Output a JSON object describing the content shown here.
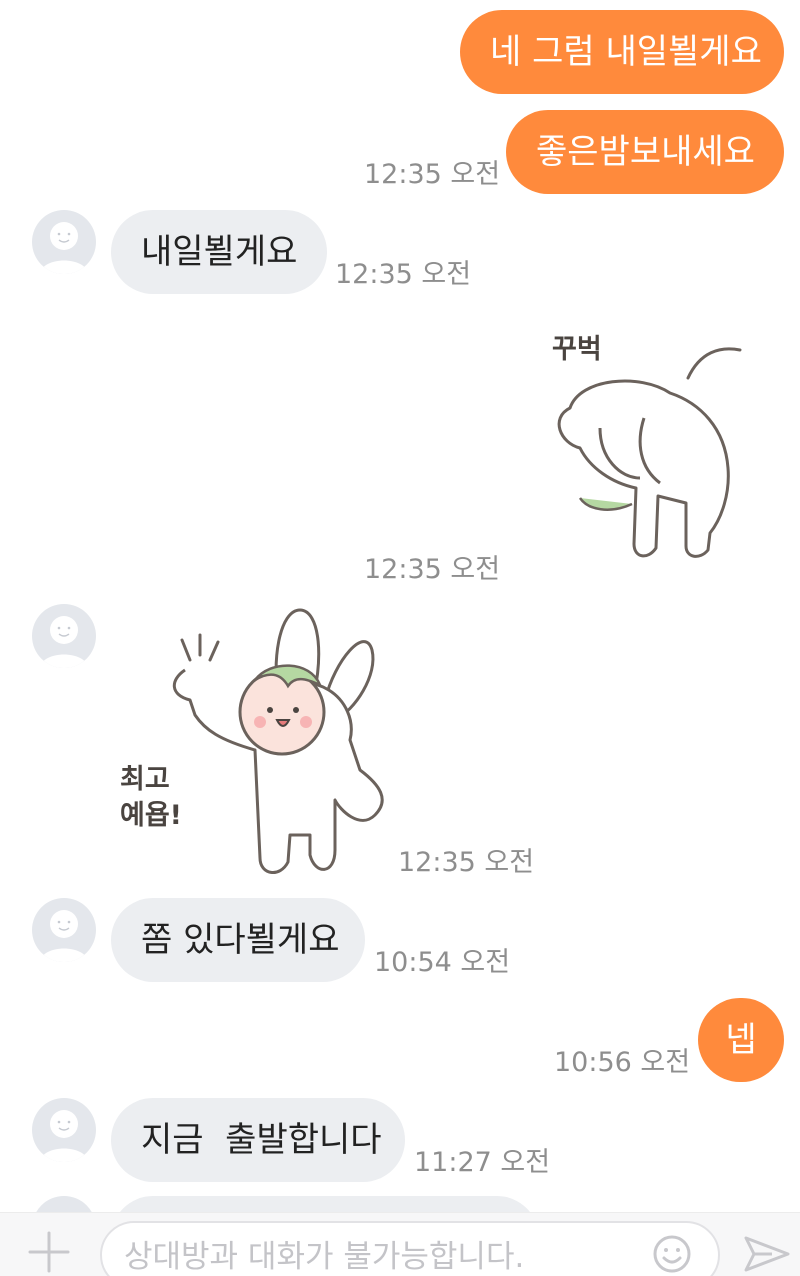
{
  "messages": [
    {
      "from": "me",
      "text": "네 그럼 내일뵐게요"
    },
    {
      "from": "me",
      "text": "좋은밤보내세요",
      "time": "12:35 오전"
    },
    {
      "from": "them",
      "text": "내일뵐게요",
      "time": "12:35 오전"
    },
    {
      "from": "me",
      "sticker_text": "꾸벅",
      "time": "12:35 오전"
    },
    {
      "from": "them",
      "sticker_text_1": "최고",
      "sticker_text_2": "예욥!",
      "time": "12:35 오전"
    },
    {
      "from": "them",
      "text": "쫌 있다뵐게요",
      "time": "10:54 오전"
    },
    {
      "from": "me",
      "text": "넵",
      "time": "10:56 오전"
    },
    {
      "from": "them",
      "text": "지금  출발합니다",
      "time": "11:27 오전"
    }
  ],
  "composer": {
    "placeholder": "상대방과 대화가 불가능합니다.",
    "plus_icon": "plus-icon",
    "emoji_icon": "emoji-icon",
    "send_icon": "send-icon"
  },
  "colors": {
    "outgoing_bubble": "#ff8a3c",
    "incoming_bubble": "#eceef1",
    "timestamp": "#8e8e8e",
    "sticker_accent": "#b5d8a2"
  }
}
